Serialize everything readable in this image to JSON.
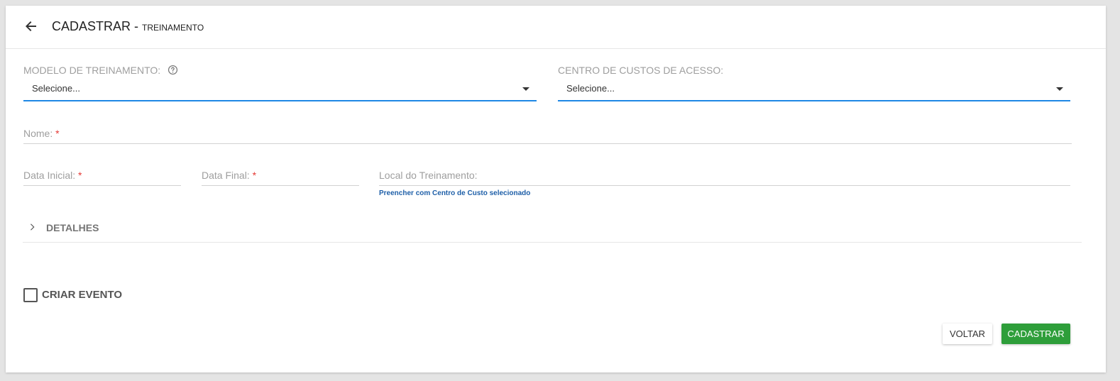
{
  "header": {
    "title": "CADASTRAR -",
    "subtitle": "TREINAMENTO"
  },
  "form": {
    "modelo": {
      "label": "MODELO DE TREINAMENTO:",
      "value": "Selecione..."
    },
    "centro_custos": {
      "label": "CENTRO DE CUSTOS DE ACESSO:",
      "value": "Selecione..."
    },
    "nome": {
      "label": "Nome:",
      "required_mark": "*"
    },
    "data_inicial": {
      "label": "Data Inicial:",
      "required_mark": "*"
    },
    "data_final": {
      "label": "Data Final:",
      "required_mark": "*"
    },
    "local": {
      "label": "Local do Treinamento:",
      "hint_link": "Preencher com Centro de Custo selecionado"
    }
  },
  "details": {
    "label": "DETALHES"
  },
  "criar_evento": {
    "label": "CRIAR EVENTO",
    "checked": false
  },
  "buttons": {
    "voltar": "VOLTAR",
    "cadastrar": "CADASTRAR"
  },
  "colors": {
    "accent_blue": "#1e88e5",
    "primary_green": "#2e9e3a",
    "required_red": "#e53935",
    "link_blue": "#1e5fa8"
  },
  "icons": {
    "back": "arrow-left-icon",
    "help": "question-circle-icon",
    "expand": "chevron-right-icon",
    "dropdown": "caret-down-icon"
  }
}
